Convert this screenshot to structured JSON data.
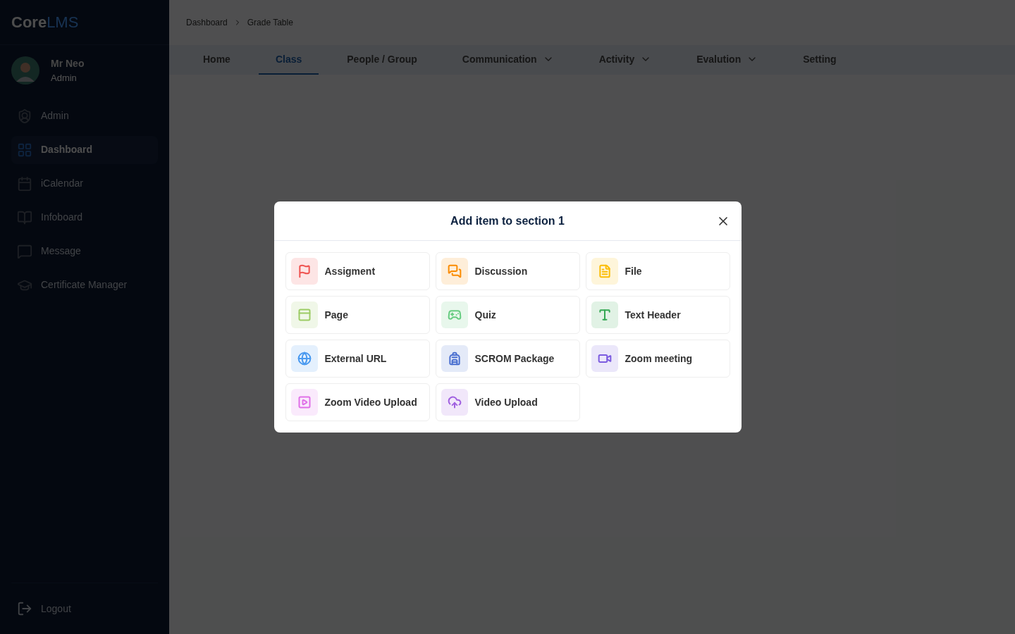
{
  "logo": {
    "bold": "Core",
    "light": "LMS"
  },
  "user": {
    "name": "Mr Neo",
    "role": "Admin"
  },
  "sidebar": {
    "items": [
      {
        "label": "Admin",
        "kind": "admin",
        "selected": false
      },
      {
        "label": "Dashboard",
        "kind": "dashboard",
        "selected": true
      },
      {
        "label": "iCalendar",
        "kind": "calendar",
        "selected": false
      },
      {
        "label": "Infoboard",
        "kind": "infoboard",
        "selected": false
      },
      {
        "label": "Message",
        "kind": "message",
        "selected": false
      },
      {
        "label": "Certificate Manager",
        "kind": "certificate",
        "selected": false
      }
    ],
    "logout": "Logout"
  },
  "breadcrumb": [
    "Dashboard",
    "Grade Table"
  ],
  "tabs": [
    {
      "label": "Home",
      "selected": false,
      "dropdown": false
    },
    {
      "label": "Class",
      "selected": true,
      "dropdown": false
    },
    {
      "label": "People / Group",
      "selected": false,
      "dropdown": false
    },
    {
      "label": "Communication",
      "selected": false,
      "dropdown": true
    },
    {
      "label": "Activity",
      "selected": false,
      "dropdown": true
    },
    {
      "label": "Evalution",
      "selected": false,
      "dropdown": true
    },
    {
      "label": "Setting",
      "selected": false,
      "dropdown": false
    }
  ],
  "dialog": {
    "title": "Add item to section 1",
    "items": [
      {
        "label": "Assigment",
        "kind": "flag",
        "color": "#ef5350"
      },
      {
        "label": "Discussion",
        "kind": "discussion",
        "color": "#fb8c00"
      },
      {
        "label": "File",
        "kind": "file",
        "color": "#fbbc05"
      },
      {
        "label": "Page",
        "kind": "page",
        "color": "#9ccc65"
      },
      {
        "label": "Quiz",
        "kind": "quiz",
        "color": "#66cc80"
      },
      {
        "label": "Text Header",
        "kind": "text",
        "color": "#34a853"
      },
      {
        "label": "External URL",
        "kind": "globe",
        "color": "#4a9af0"
      },
      {
        "label": "SCROM Package",
        "kind": "package",
        "color": "#4a6fd0"
      },
      {
        "label": "Zoom meeting",
        "kind": "zoom",
        "color": "#7c5ce0"
      },
      {
        "label": "Zoom Video Upload",
        "kind": "video",
        "color": "#e070e8"
      },
      {
        "label": "Video Upload",
        "kind": "upload",
        "color": "#a060e0"
      }
    ]
  }
}
